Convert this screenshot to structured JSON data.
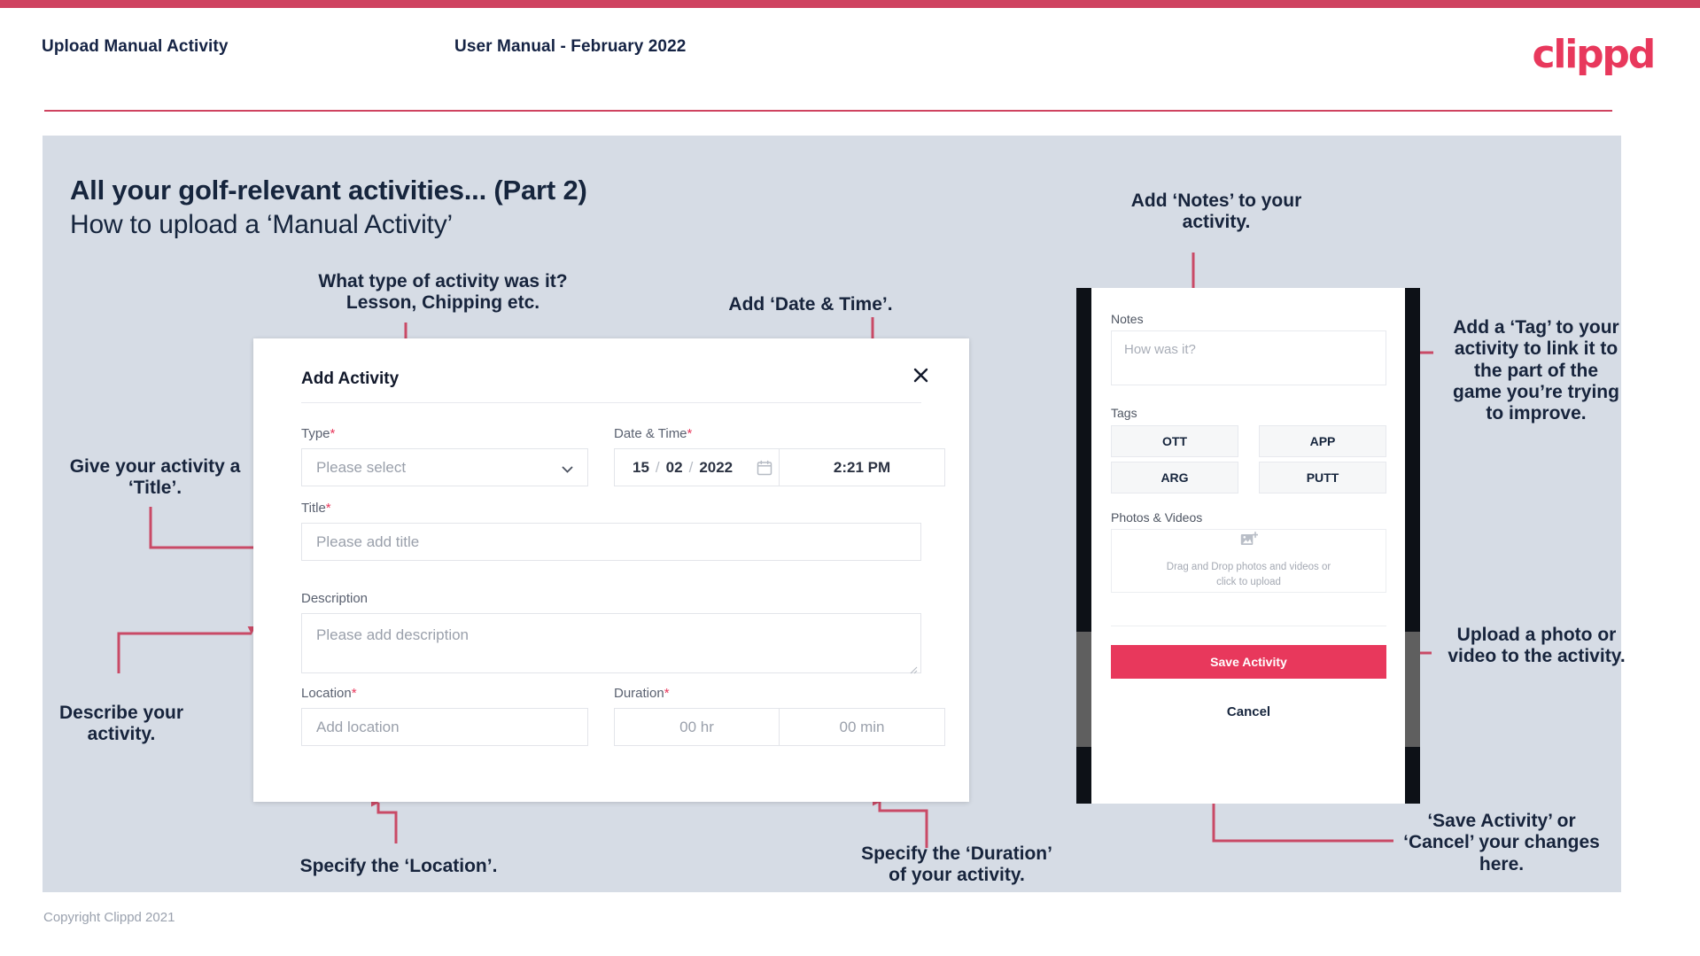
{
  "header": {
    "title": "Upload Manual Activity",
    "subtitle": "User Manual - February 2022",
    "brand": "clippd"
  },
  "slide": {
    "title": "All your golf-relevant activities... (Part 2)",
    "subtitle": "How to upload a ‘Manual Activity’",
    "copyright": "Copyright Clippd 2021"
  },
  "annotations": {
    "type": "What type of activity was it?\nLesson, Chipping etc.",
    "date_time": "Add ‘Date & Time’.",
    "title": "Give your activity a\n‘Title’.",
    "description": "Describe your\nactivity.",
    "location": "Specify the ‘Location’.",
    "duration": "Specify the ‘Duration’\nof your activity.",
    "notes": "Add ‘Notes’ to your\nactivity.",
    "tags": "Add a ‘Tag’ to your\nactivity to link it to\nthe part of the\ngame you’re trying\nto improve.",
    "photos": "Upload a photo or\nvideo to the activity.",
    "save_cancel": "‘Save Activity’ or\n‘Cancel’ your changes\nhere."
  },
  "dialog": {
    "title": "Add Activity",
    "close_icon": "close-icon",
    "fields": {
      "type": {
        "label": "Type",
        "required": "*",
        "placeholder": "Please select"
      },
      "date_time": {
        "label": "Date & Time",
        "required": "*",
        "day": "15",
        "month": "02",
        "year": "2022",
        "sep": "/",
        "time": "2:21 PM"
      },
      "title": {
        "label": "Title",
        "required": "*",
        "placeholder": "Please add title"
      },
      "description": {
        "label": "Description",
        "required": "",
        "placeholder": "Please add description"
      },
      "location": {
        "label": "Location",
        "required": "*",
        "placeholder": "Add location"
      },
      "duration": {
        "label": "Duration",
        "required": "*",
        "hours_placeholder": "00 hr",
        "minutes_placeholder": "00 min"
      }
    }
  },
  "phone": {
    "notes": {
      "label": "Notes",
      "placeholder": "How was it?"
    },
    "tags": {
      "label": "Tags",
      "items": [
        "OTT",
        "APP",
        "ARG",
        "PUTT"
      ]
    },
    "photos": {
      "label": "Photos & Videos",
      "dropzone_line1": "Drag and Drop photos and videos or",
      "dropzone_line2": "click to upload",
      "icon": "add-image-icon"
    },
    "save_label": "Save Activity",
    "cancel_label": "Cancel"
  },
  "colors": {
    "brand_pink": "#e8385c",
    "accent_rule": "#cf4360",
    "slide_bg": "#d6dce5",
    "dark_navy": "#16253d",
    "arrow": "#c94a66"
  }
}
